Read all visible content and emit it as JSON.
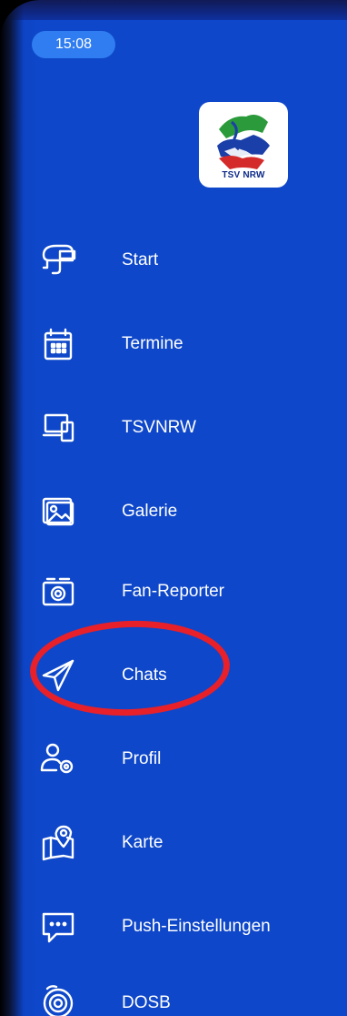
{
  "status_bar": {
    "time": "15:08"
  },
  "brand": {
    "logo_text": "TSV NRW",
    "colors": {
      "green": "#2a9a3a",
      "red": "#d42a2a",
      "blue": "#1b3fa8"
    }
  },
  "menu": {
    "items": [
      {
        "label": "Start",
        "icon": "helmet-icon"
      },
      {
        "label": "Termine",
        "icon": "calendar-icon"
      },
      {
        "label": "TSVNRW",
        "icon": "devices-icon"
      },
      {
        "label": "Galerie",
        "icon": "gallery-icon"
      },
      {
        "label": "Fan-Reporter",
        "icon": "camera-icon"
      },
      {
        "label": "Chats",
        "icon": "paper-plane-icon"
      },
      {
        "label": "Profil",
        "icon": "user-settings-icon"
      },
      {
        "label": "Karte",
        "icon": "map-icon"
      },
      {
        "label": "Push-Einstellungen",
        "icon": "chat-bubble-icon"
      },
      {
        "label": "DOSB",
        "icon": "target-icon"
      }
    ]
  },
  "highlight": {
    "target": "Chats",
    "color": "#e8202a"
  }
}
